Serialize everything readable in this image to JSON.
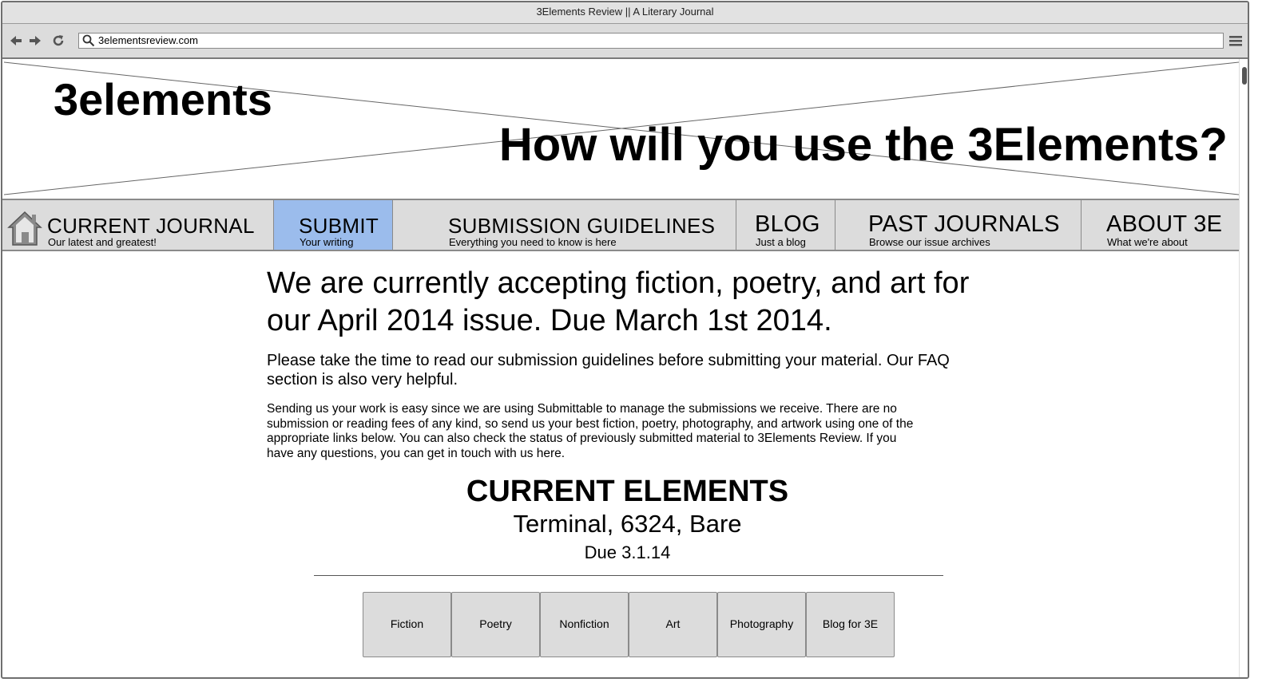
{
  "browser": {
    "title": "3Elements Review || A Literary Journal",
    "url": "3elementsreview.com"
  },
  "banner": {
    "logo": "3elements",
    "tagline": "How will you use the 3Elements?"
  },
  "nav": {
    "items": [
      {
        "title": "CURRENT JOURNAL",
        "subtitle": "Our latest and greatest!",
        "icon": "home-icon"
      },
      {
        "title": "SUBMIT",
        "subtitle": "Your writing",
        "active": true
      },
      {
        "title": "SUBMISSION GUIDELINES",
        "subtitle": "Everything you need to know is here"
      },
      {
        "title": "BLOG",
        "subtitle": "Just a blog"
      },
      {
        "title": "PAST JOURNALS",
        "subtitle": "Browse our issue archives"
      },
      {
        "title": "ABOUT 3E",
        "subtitle": "What we're about"
      }
    ]
  },
  "main": {
    "headline": "We are currently accepting fiction, poetry, and art for our April 2014 issue. Due March 1st 2014.",
    "lead": "Please take the time to read our submission guidelines before submitting your material. Our FAQ section is also very helpful.",
    "body": "Sending us your work is easy since we are using Submittable to manage the submissions we receive. There are no submission or reading fees of any kind, so send us your best fiction, poetry, photography, and artwork using one of the appropriate links below. You can also check the status of previously submitted material to 3Elements Review. If you have any questions, you can get in touch with us here."
  },
  "current_elements": {
    "title": "CURRENT ELEMENTS",
    "words": "Terminal, 6324, Bare",
    "due": "Due 3.1.14"
  },
  "submit_buttons": [
    "Fiction",
    "Poetry",
    "Nonfiction",
    "Art",
    "Photography",
    "Blog for 3E"
  ],
  "colors": {
    "active_nav": "#9bbcec",
    "chrome": "#dcdcdc"
  }
}
